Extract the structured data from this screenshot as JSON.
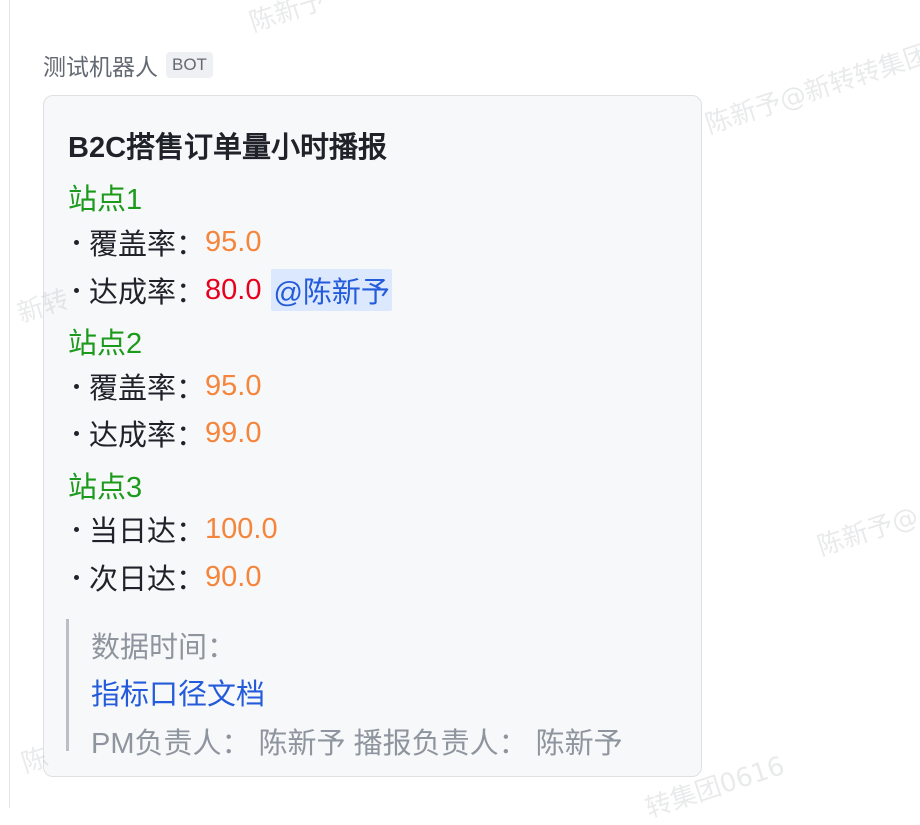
{
  "watermark": {
    "entries": [
      "陈新予",
      "陈新予@新转转集团",
      "陈新予@",
      "陈新予",
      "新转",
      "陈",
      "转集团0616"
    ]
  },
  "message": {
    "sender_name": "测试机器人",
    "sender_badge": "BOT"
  },
  "card": {
    "title": "B2C搭售订单量小时播报",
    "sections": [
      {
        "name": "站点1",
        "rows": [
          {
            "label": "覆盖率：",
            "value": "95.0",
            "color": "#f5853b"
          },
          {
            "label": "达成率：",
            "value": "80.0",
            "color": "#e8001c",
            "mention": "@陈新予"
          }
        ]
      },
      {
        "name": "站点2",
        "rows": [
          {
            "label": "覆盖率：",
            "value": "95.0",
            "color": "#f5853b"
          },
          {
            "label": "达成率：",
            "value": "99.0",
            "color": "#f5853b"
          }
        ]
      },
      {
        "name": "站点3",
        "rows": [
          {
            "label": "当日达：",
            "value": "100.0",
            "color": "#f5853b"
          },
          {
            "label": "次日达：",
            "value": "90.0",
            "color": "#f5853b"
          }
        ]
      }
    ],
    "note": {
      "data_time_label": "数据时间：",
      "doc_link": "指标口径文档",
      "owners": "PM负责人：  陈新予  播报负责人：  陈新予"
    }
  },
  "colors": {
    "site_green": "#1b9a1b",
    "value_orange": "#f5853b",
    "value_red": "#e8001c",
    "mention_blue": "#245bdb",
    "mention_bg": "#dbe8fd"
  }
}
